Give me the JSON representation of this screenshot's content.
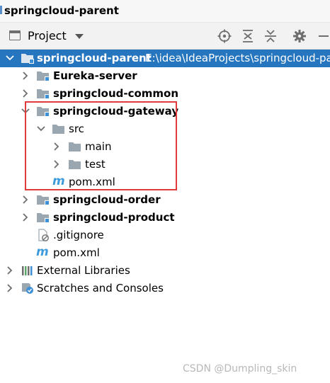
{
  "window": {
    "title": "springcloud-parent"
  },
  "toolbar": {
    "view_label": "Project",
    "buttons": [
      "locate-icon",
      "expand-all-icon",
      "collapse-all-icon",
      "gear-icon",
      "minimize-icon"
    ]
  },
  "tree": {
    "root": {
      "label": "springcloud-parent",
      "path": "E:\\idea\\IdeaProjects\\springcloud-pa"
    },
    "eureka": {
      "label": "Eureka-server"
    },
    "common": {
      "label": "springcloud-common"
    },
    "gateway": {
      "label": "springcloud-gateway",
      "src": "src",
      "main": "main",
      "test": "test",
      "pom": "pom.xml"
    },
    "order": {
      "label": "springcloud-order"
    },
    "product": {
      "label": "springcloud-product"
    },
    "gitignore": {
      "label": ".gitignore"
    },
    "pom": {
      "label": "pom.xml"
    },
    "external": {
      "label": "External Libraries"
    },
    "scratches": {
      "label": "Scratches and Consoles"
    }
  },
  "watermark": "CSDN @Dumpling_skin",
  "colors": {
    "selection": "#2675bf",
    "highlight_border": "#e03a3a",
    "maven_icon": "#3b9bdc",
    "folder": "#9aa7b0",
    "module_badge": "#3d8fd6"
  }
}
